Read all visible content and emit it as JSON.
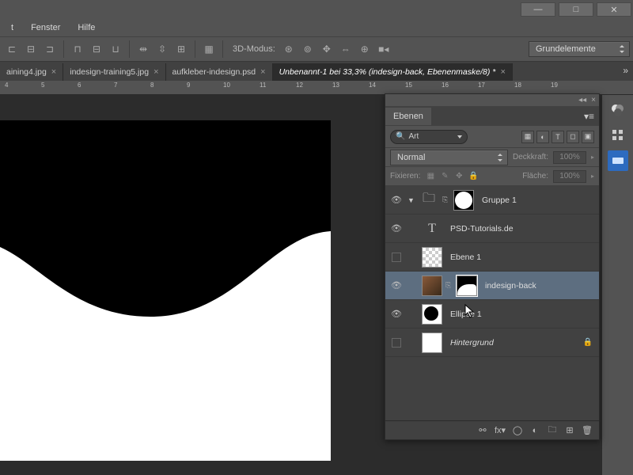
{
  "menubar": {
    "fenster": "Fenster",
    "hilfe": "Hilfe",
    "unknown": "t"
  },
  "window": {
    "minimize": "—",
    "maximize": "□",
    "close": "✕"
  },
  "options": {
    "label_3d": "3D-Modus:",
    "workspace": "Grundelemente"
  },
  "tabs": {
    "overflow": "»",
    "items": [
      {
        "label": "aining4.jpg",
        "active": false
      },
      {
        "label": "indesign-training5.jpg",
        "active": false
      },
      {
        "label": "aufkleber-indesign.psd",
        "active": false
      },
      {
        "label": "Unbenannt-1 bei 33,3% (indesign-back, Ebenenmaske/8) *",
        "active": true
      }
    ]
  },
  "ruler": {
    "ticks": [
      "4",
      "5",
      "6",
      "7",
      "8",
      "9",
      "10",
      "11",
      "12",
      "13",
      "14",
      "15",
      "16",
      "17",
      "18",
      "19"
    ]
  },
  "layers_panel": {
    "title": "Ebenen",
    "search_mode": "Art",
    "blend_mode": "Normal",
    "opacity_label": "Deckkraft:",
    "opacity_value": "100%",
    "lock_label": "Fixieren:",
    "fill_label": "Fläche:",
    "fill_value": "100%",
    "layers": [
      {
        "name": "Gruppe 1",
        "type": "group",
        "vis": true
      },
      {
        "name": "PSD-Tutorials.de",
        "type": "text",
        "vis": true
      },
      {
        "name": "Ebene 1",
        "type": "layer",
        "vis": false
      },
      {
        "name": "indesign-back",
        "type": "masked",
        "vis": true,
        "selected": true
      },
      {
        "name": "Ellipse 1",
        "type": "shape",
        "vis": true
      },
      {
        "name": "Hintergrund",
        "type": "bg",
        "vis": false,
        "locked": true
      }
    ]
  }
}
